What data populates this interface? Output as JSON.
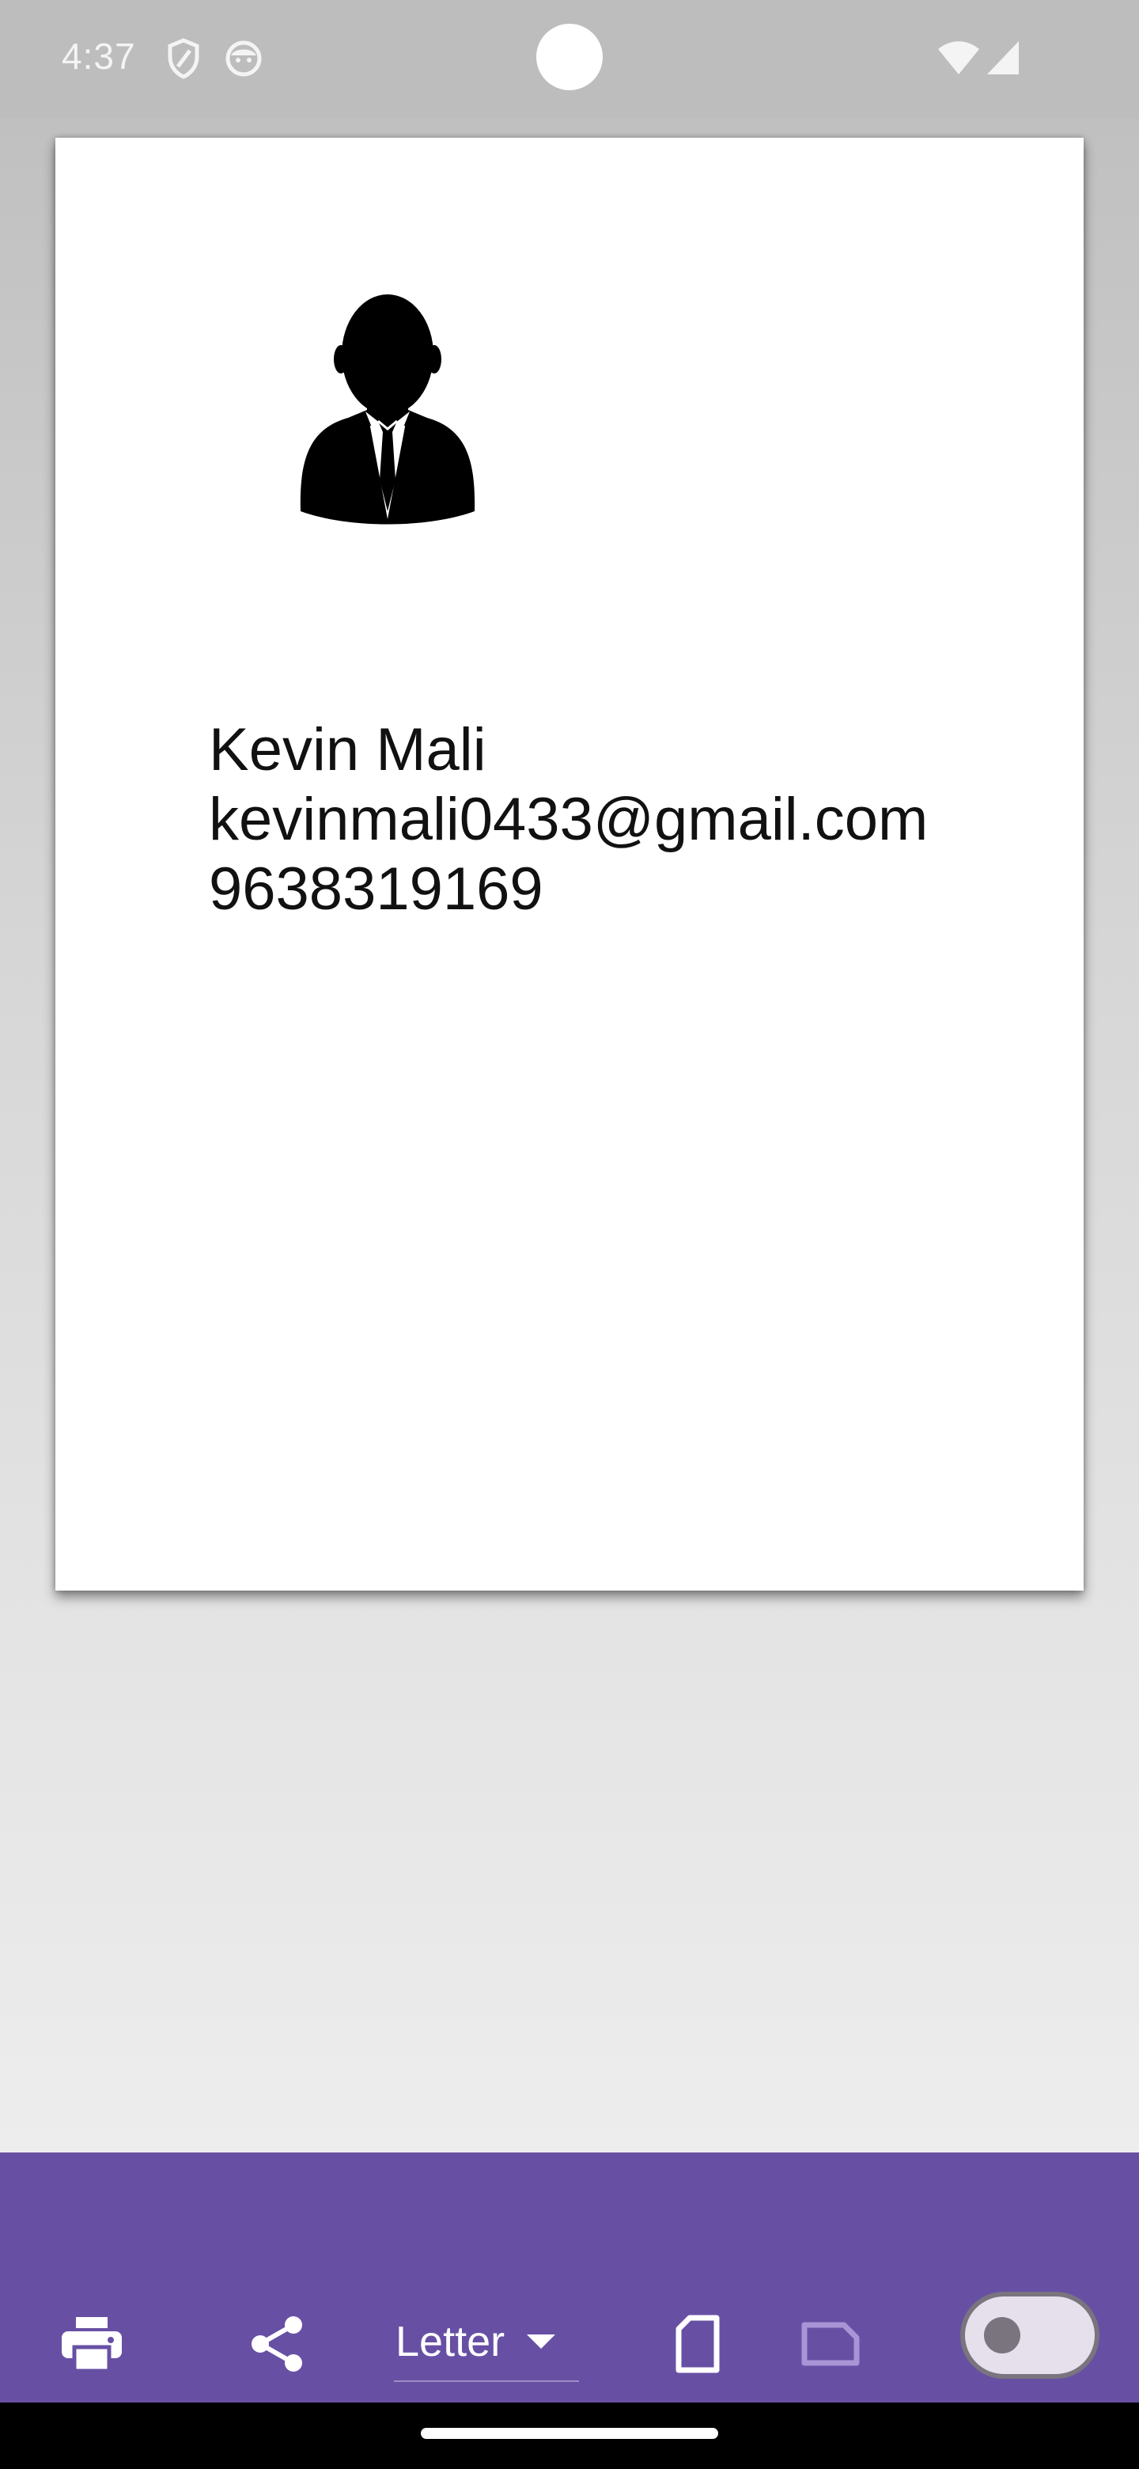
{
  "status_bar": {
    "time": "4:37",
    "icons": [
      "shield-icon",
      "face-icon",
      "wifi-icon",
      "cellular-signal-icon"
    ]
  },
  "document": {
    "avatar_icon": "person-in-suit-icon",
    "name": "Kevin Mali",
    "email": "kevinmali0433@gmail.com",
    "phone": "9638319169"
  },
  "toolbar": {
    "background_color": "#6750a4",
    "print_icon": "print-icon",
    "share_icon": "share-icon",
    "paper_size": "Letter",
    "paper_dropdown_icon": "arrow-drop-down-icon",
    "portrait_icon": "portrait-page-icon",
    "landscape_icon": "landscape-page-icon",
    "toggle_state": "off"
  }
}
